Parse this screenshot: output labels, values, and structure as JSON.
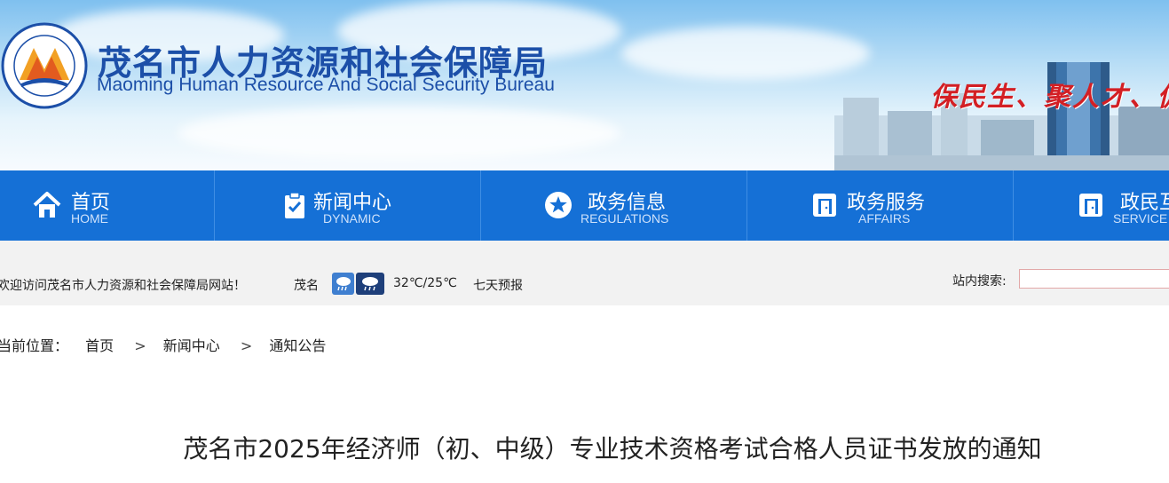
{
  "header": {
    "title": "茂名市人力资源和社会保障局",
    "subtitle": "Maoming Human Resource And Social Security Bureau",
    "slogan": "保民生、聚人才、促",
    "logo_icon": "bureau-emblem-icon",
    "brand_color": "#1c4fa8",
    "slogan_color": "#d31f24"
  },
  "nav": {
    "background": "#1570d6",
    "items": [
      {
        "label": "首页",
        "en": "HOME",
        "icon": "home-icon"
      },
      {
        "label": "新闻中心",
        "en": "DYNAMIC",
        "icon": "clipboard-check-icon"
      },
      {
        "label": "政务信息",
        "en": "REGULATIONS",
        "icon": "star-circle-icon"
      },
      {
        "label": "政务服务",
        "en": "AFFAIRS",
        "icon": "door-exit-icon"
      },
      {
        "label": "政民互",
        "en": "SERVICE",
        "icon": "door-exit-icon"
      }
    ]
  },
  "infobar": {
    "welcome": "欢迎访问茂名市人力资源和社会保障局网站！",
    "city": "茂名",
    "weather_icons": [
      "rain-day-icon",
      "rain-night-icon"
    ],
    "temperature": "32℃/25℃",
    "forecast_link": "七天预报",
    "search_label": "站内搜索:",
    "search_value": ""
  },
  "breadcrumb": {
    "prefix": "当前位置：",
    "items": [
      "首页",
      "新闻中心",
      "通知公告"
    ],
    "separator": ">"
  },
  "article": {
    "title": "茂名市2025年经济师（初、中级）专业技术资格考试合格人员证书发放的通知"
  }
}
